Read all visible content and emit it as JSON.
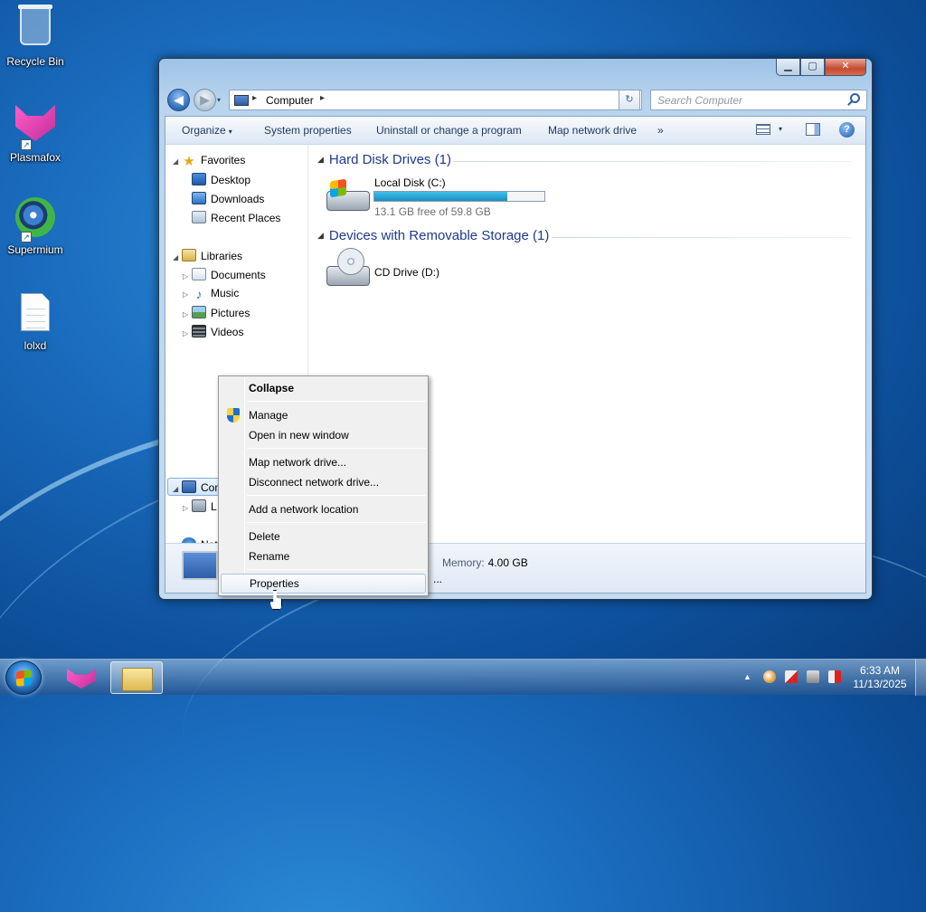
{
  "desktop": {
    "icons": [
      {
        "label": "Recycle Bin",
        "icon": "recycle-bin-icon"
      },
      {
        "label": "Plasmafox",
        "icon": "plasmafox-icon"
      },
      {
        "label": "Supermium",
        "icon": "supermium-icon"
      },
      {
        "label": "lolxd",
        "icon": "text-file-icon"
      }
    ]
  },
  "window": {
    "controls": {
      "minimize": "▁",
      "maximize": "▢",
      "close": "✕"
    },
    "address": {
      "crumbs": [
        "Computer"
      ],
      "separator": "▸",
      "dropdown": "▾"
    },
    "refresh": "↻",
    "search": {
      "placeholder": "Search Computer"
    },
    "back": "◀",
    "forward": "▶",
    "commands": [
      {
        "label": "Organize",
        "has_dropdown": true
      },
      {
        "label": "System properties"
      },
      {
        "label": "Uninstall or change a program"
      },
      {
        "label": "Map network drive"
      },
      {
        "label": "»"
      }
    ],
    "caret": "▾",
    "help": "?",
    "nav": {
      "favorites": {
        "label": "Favorites",
        "items": [
          "Desktop",
          "Downloads",
          "Recent Places"
        ]
      },
      "libraries": {
        "label": "Libraries",
        "items": [
          "Documents",
          "Music",
          "Pictures",
          "Videos"
        ]
      },
      "computer": {
        "label": "Computer",
        "children": [
          "L"
        ]
      },
      "network": {
        "label": "Net"
      },
      "expanded_glyph": "◢",
      "collapsed_glyph": "▷"
    },
    "groups": [
      {
        "title": "Hard Disk Drives (1)"
      },
      {
        "title": "Devices with Removable Storage (1)"
      }
    ],
    "group_toggle": "◢",
    "drives": {
      "local": {
        "name": "Local Disk (C:)",
        "free_text": "13.1 GB free of 59.8 GB",
        "used_fraction": 0.78
      },
      "cd": {
        "name": "CD Drive (D:)"
      }
    },
    "details": {
      "memory_label": "Memory:",
      "memory_value": "4.00 GB",
      "truncated": "..."
    }
  },
  "context_menu": {
    "items": {
      "collapse": "Collapse",
      "manage": "Manage",
      "open_new": "Open in new window",
      "map": "Map network drive...",
      "disconnect": "Disconnect network drive...",
      "add_location": "Add a network location",
      "delete": "Delete",
      "rename": "Rename",
      "properties": "Properties"
    }
  },
  "taskbar": {
    "tray_expand": "▲",
    "clock": {
      "time": "6:33 AM",
      "date": "11/13/2025"
    }
  },
  "colors": {
    "accent": "#1e3a8c",
    "drive_fill": "#1b8fc2",
    "window_frame": "#9ec3e6"
  }
}
